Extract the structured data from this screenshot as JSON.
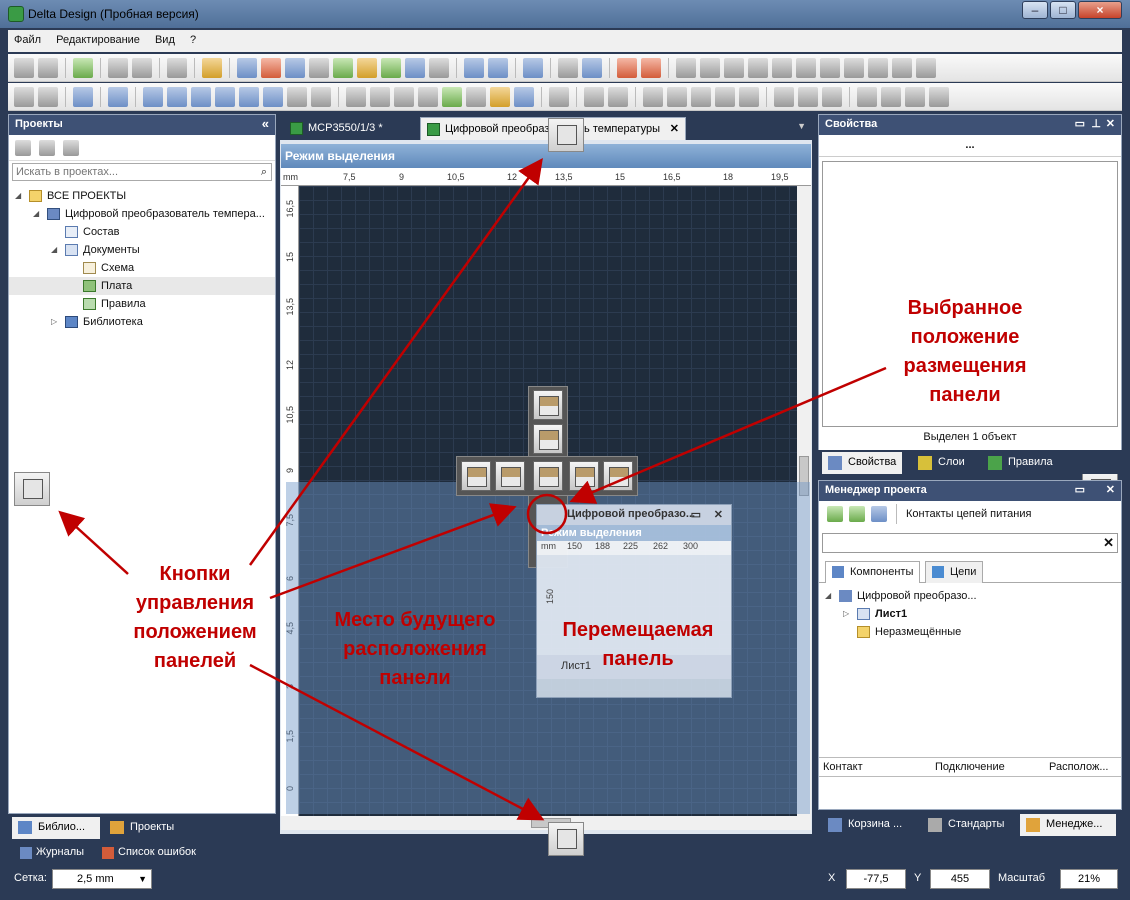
{
  "window": {
    "title": "Delta Design (Пробная версия)"
  },
  "menu": [
    "Файл",
    "Редактирование",
    "Вид",
    "?"
  ],
  "left_panel": {
    "title": "Проекты",
    "search_placeholder": "Искать в проектах...",
    "tree": [
      {
        "label": "ВСЕ ПРОЕКТЫ",
        "level": 0,
        "expanded": true,
        "icon": "folder-icon"
      },
      {
        "label": "Цифровой преобразователь темпера...",
        "level": 1,
        "expanded": true,
        "icon": "project-icon"
      },
      {
        "label": "Состав",
        "level": 2,
        "icon": "composition-icon"
      },
      {
        "label": "Документы",
        "level": 2,
        "expanded": true,
        "icon": "documents-icon"
      },
      {
        "label": "Схема",
        "level": 3,
        "icon": "schematic-icon"
      },
      {
        "label": "Плата",
        "level": 3,
        "icon": "board-icon",
        "selected": true
      },
      {
        "label": "Правила",
        "level": 3,
        "icon": "rules-icon"
      },
      {
        "label": "Библиотека",
        "level": 2,
        "expanded": false,
        "icon": "library-icon"
      }
    ],
    "bottom_tabs": [
      "Библио...",
      "Проекты"
    ]
  },
  "log_tabs": [
    "Журналы",
    "Список ошибок"
  ],
  "status": {
    "grid_label": "Сетка:",
    "grid_value": "2,5 mm",
    "x_label": "X",
    "x_value": "-77,5",
    "y_label": "Y",
    "y_value": "455",
    "zoom_label": "Масштаб",
    "zoom_value": "21%"
  },
  "documents": {
    "tabs": [
      "MCP3550/1/3 *",
      "Цифровой преобразователь температуры"
    ],
    "mode_label": "Режим выделения",
    "ruler_unit": "mm",
    "hruler_ticks": [
      "7,5",
      "9",
      "10,5",
      "12",
      "13,5",
      "15",
      "16,5",
      "18",
      "19,5"
    ],
    "vruler_ticks": [
      "16,5",
      "15",
      "13,5",
      "12",
      "10,5",
      "9",
      "7,5",
      "6",
      "4,5",
      "3",
      "1,5",
      "0"
    ]
  },
  "floating_panel": {
    "title": "Цифровой преобразо...",
    "mode_label": "Режим выделения",
    "ruler_unit": "mm",
    "ruler_ticks": [
      "150",
      "188",
      "225",
      "262",
      "300"
    ],
    "vruler_tick": "150",
    "sheet_tab": "Лист1"
  },
  "properties_panel": {
    "title": "Свойства",
    "object_name": "...",
    "selection_count": "Выделен 1 объект",
    "tabs": [
      "Свойства",
      "Слои",
      "Правила"
    ]
  },
  "project_manager": {
    "title": "Менеджер проекта",
    "toolbar_label": "Контакты цепей питания",
    "tabs": [
      "Компоненты",
      "Цепи"
    ],
    "tree": [
      {
        "label": "Цифровой преобразо...",
        "level": 0,
        "icon": "project-icon"
      },
      {
        "label": "Лист1",
        "level": 1,
        "icon": "sheet-icon",
        "bold": true
      },
      {
        "label": "Неразмещённые",
        "level": 1,
        "icon": "folder-icon"
      }
    ],
    "columns": [
      "Контакт",
      "Подключение",
      "Располож..."
    ],
    "bottom_tabs": [
      "Корзина ...",
      "Стандарты",
      "Менедже..."
    ]
  },
  "annotations": {
    "selected_position": "Выбранное положение размещения панели",
    "control_buttons": "Кнопки управления положением панелей",
    "future_place": "Место будущего расположения панели",
    "moving_panel": "Перемещаемая панель"
  },
  "colors": {
    "annotation": "#c00000",
    "workspace_bg": "#2b3a55",
    "canvas_bg": "#1f2c3c",
    "mode_bar": "#6f97c6"
  }
}
